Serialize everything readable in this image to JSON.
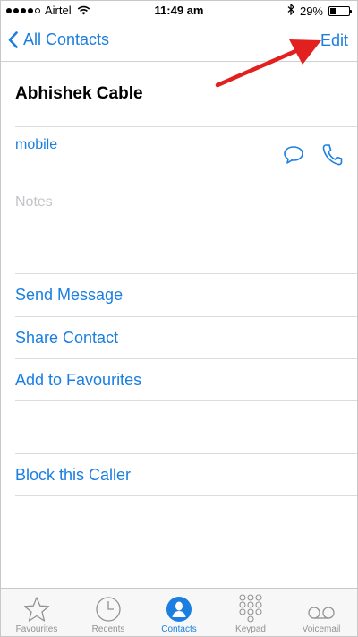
{
  "status_bar": {
    "carrier": "Airtel",
    "time": "11:49 am",
    "battery": "29%",
    "battery_level": 0.29
  },
  "nav": {
    "back_label": "All Contacts",
    "edit_label": "Edit"
  },
  "contact": {
    "name": "Abhishek Cable",
    "phone_label": "mobile",
    "notes_placeholder": "Notes"
  },
  "actions": {
    "send_message": "Send Message",
    "share_contact": "Share Contact",
    "add_favourites": "Add to Favourites",
    "block_caller": "Block this Caller"
  },
  "tabs": [
    {
      "label": "Favourites",
      "icon": "star-icon"
    },
    {
      "label": "Recents",
      "icon": "clock-icon"
    },
    {
      "label": "Contacts",
      "icon": "person-icon"
    },
    {
      "label": "Keypad",
      "icon": "keypad-icon"
    },
    {
      "label": "Voicemail",
      "icon": "voicemail-icon"
    }
  ],
  "colors": {
    "accent": "#1a7fe0",
    "annotation_arrow": "#e32020",
    "notes_placeholder": "#c3c3c8",
    "tab_inactive": "#929292"
  }
}
